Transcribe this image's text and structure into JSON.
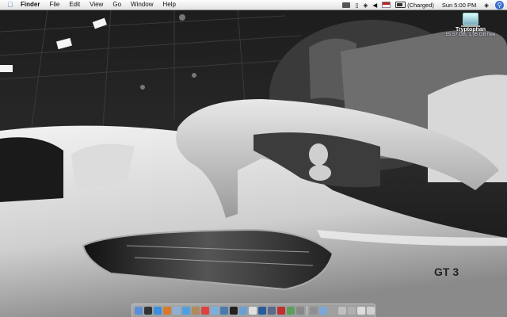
{
  "menubar": {
    "app_name": "Finder",
    "items": [
      "File",
      "Edit",
      "View",
      "Go",
      "Window",
      "Help"
    ],
    "battery_status": "(Charged)",
    "clock": "Sun 5:00 PM"
  },
  "desktop": {
    "disk_name": "Tryptophan",
    "disk_info": "55.57 GB, 1.95 GB free",
    "wallpaper_text": "GT 3"
  },
  "dock": {
    "icons": [
      {
        "name": "finder-icon",
        "color": "#5a8fd8"
      },
      {
        "name": "dashboard-icon",
        "color": "#333333"
      },
      {
        "name": "safari-icon",
        "color": "#3b8ee0"
      },
      {
        "name": "firefox-icon",
        "color": "#d87a2a"
      },
      {
        "name": "mail-icon",
        "color": "#8fb0d8"
      },
      {
        "name": "ichat-icon",
        "color": "#4fa0e0"
      },
      {
        "name": "address-book-icon",
        "color": "#b08a5a"
      },
      {
        "name": "ical-icon",
        "color": "#e04040"
      },
      {
        "name": "itunes-icon",
        "color": "#7ab0e0"
      },
      {
        "name": "iphoto-icon",
        "color": "#4a7ab0"
      },
      {
        "name": "terminal-icon",
        "color": "#222222"
      },
      {
        "name": "preview-icon",
        "color": "#6aa0d0"
      },
      {
        "name": "textedit-icon",
        "color": "#e0e0e0"
      },
      {
        "name": "photoshop-icon",
        "color": "#2a5a9a"
      },
      {
        "name": "xcode-icon",
        "color": "#5a6a8a"
      },
      {
        "name": "filezilla-icon",
        "color": "#c03030"
      },
      {
        "name": "activity-monitor-icon",
        "color": "#5aa05a"
      },
      {
        "name": "system-preferences-icon",
        "color": "#888888"
      }
    ],
    "right_icons": [
      {
        "name": "application-icon",
        "color": "#909090"
      },
      {
        "name": "documents-folder-icon",
        "color": "#7aa8d8"
      },
      {
        "name": "image-file-icon",
        "color": "#a0a0a0"
      },
      {
        "name": "window-icon",
        "color": "#c0c0c0"
      },
      {
        "name": "minimized-window-icon",
        "color": "#b0b0b0"
      },
      {
        "name": "text-file-icon",
        "color": "#dddddd"
      },
      {
        "name": "trash-icon",
        "color": "#d0d0d0"
      }
    ]
  }
}
